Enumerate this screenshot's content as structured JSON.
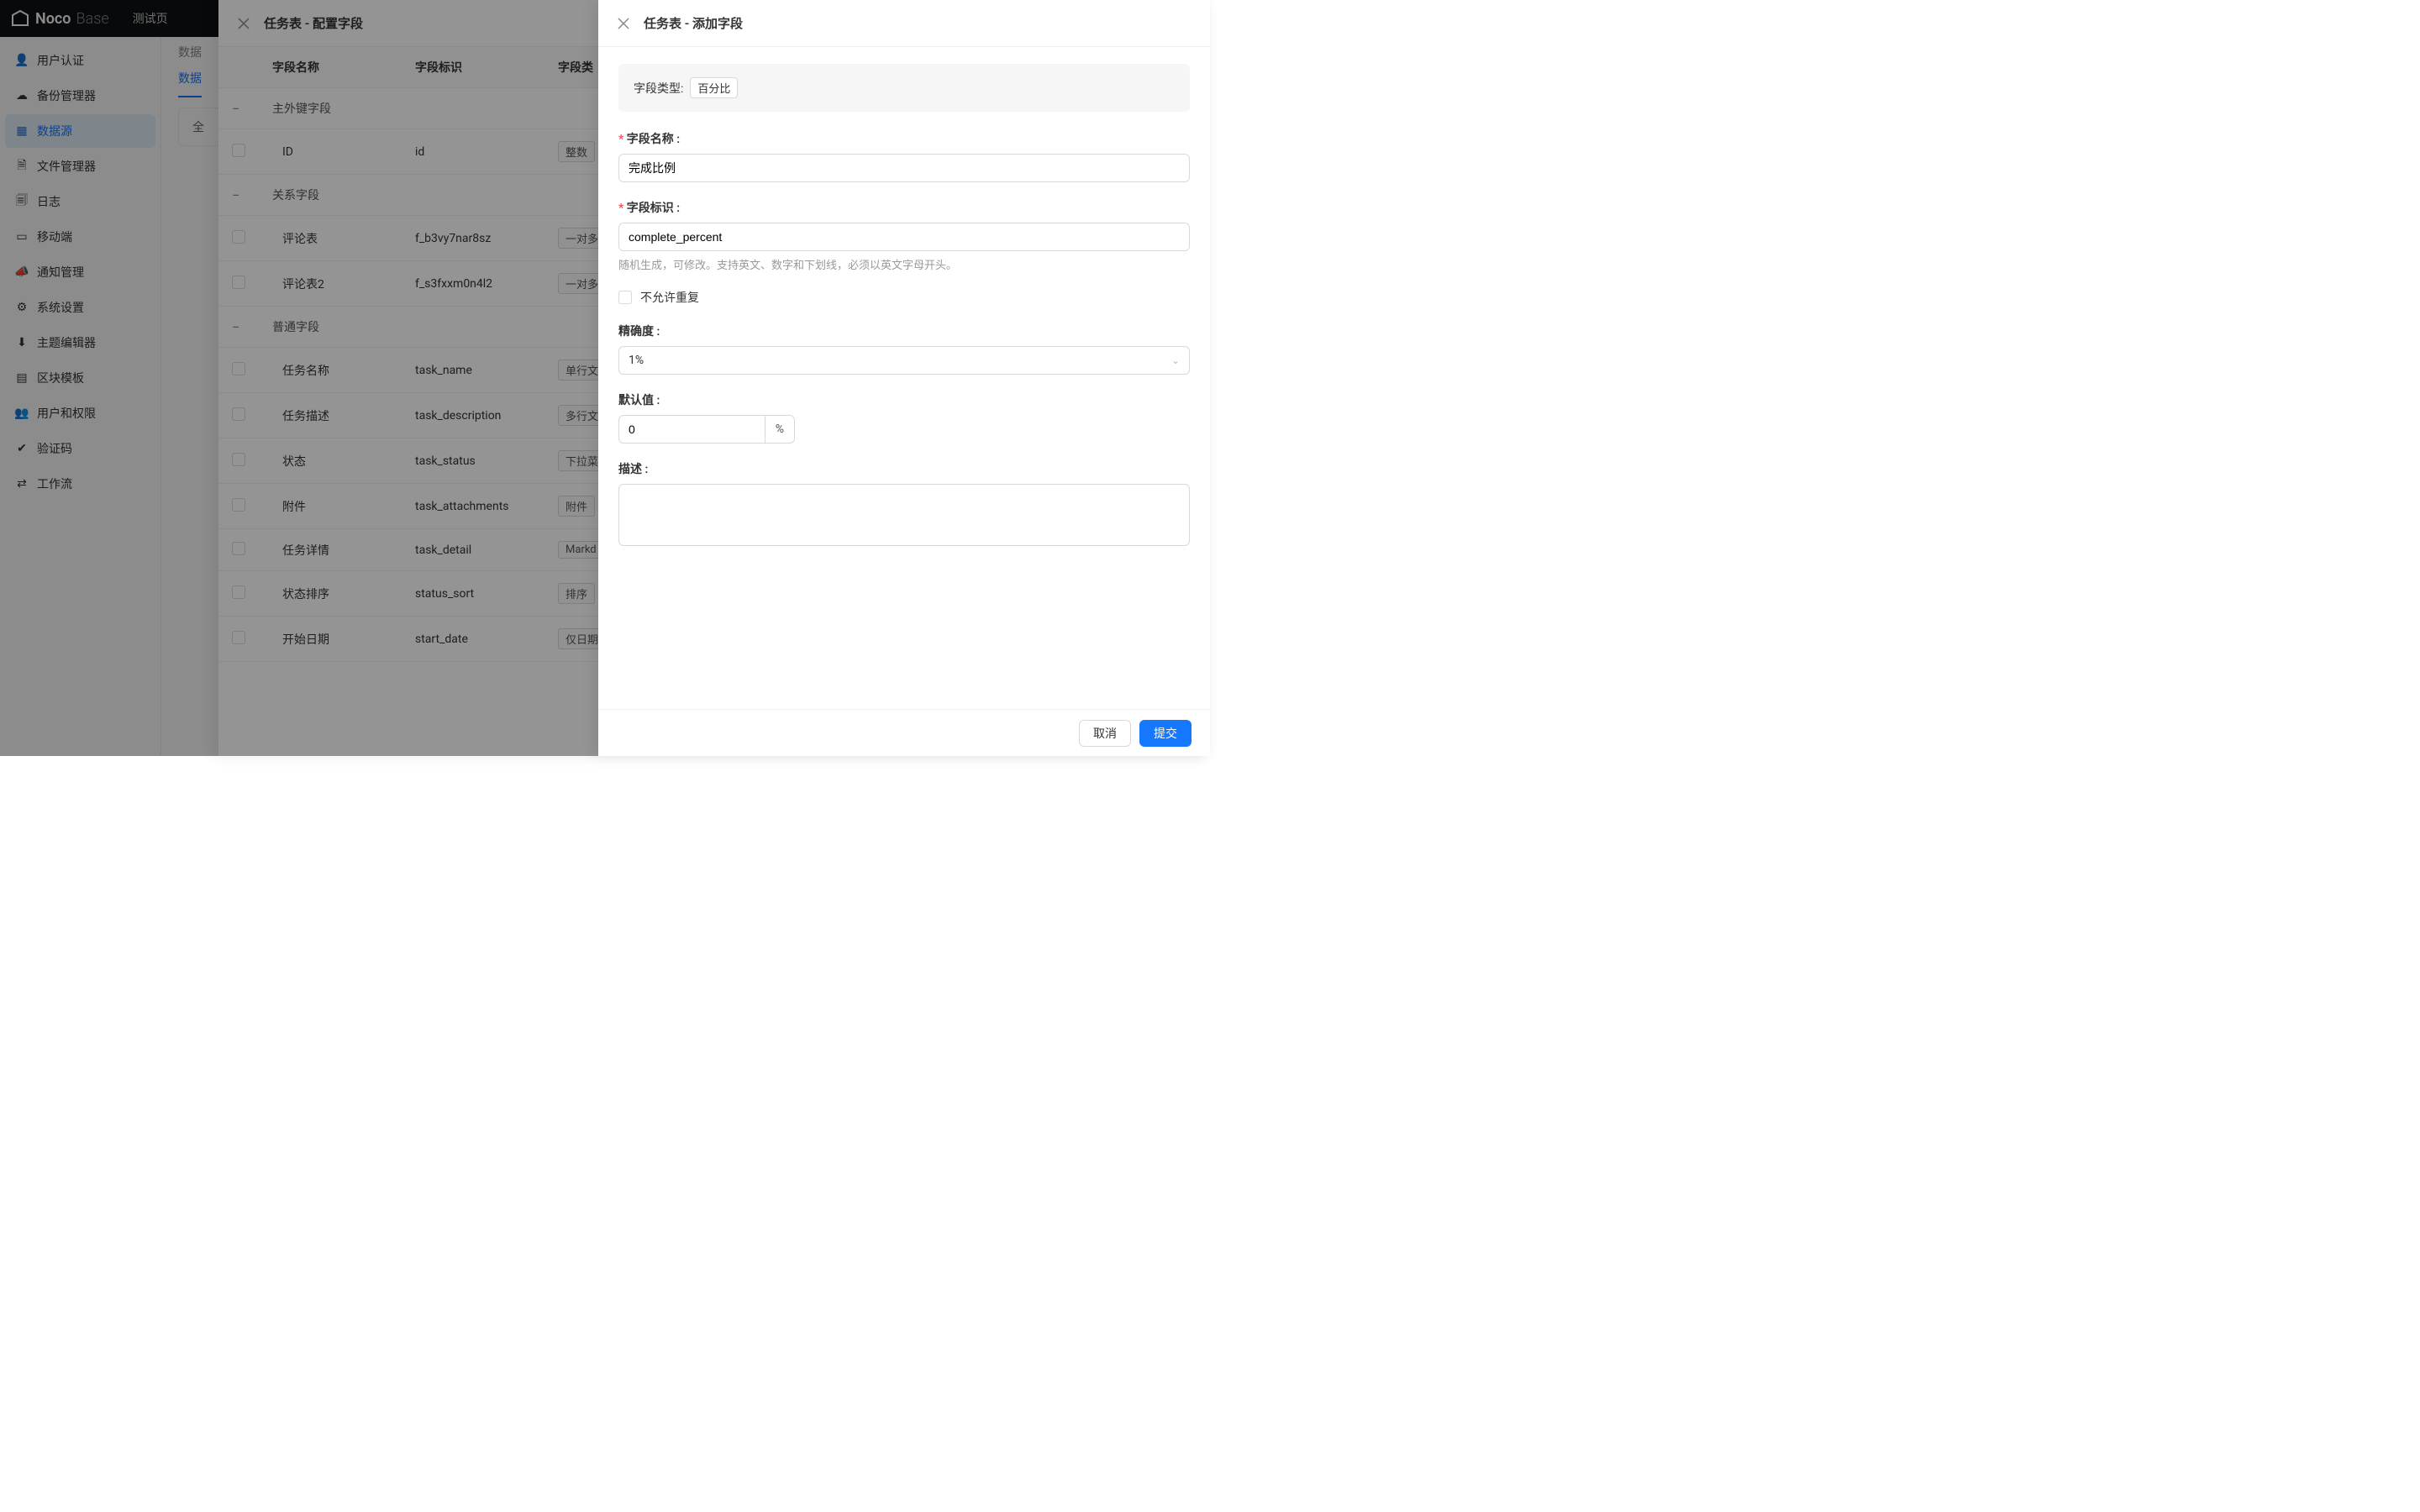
{
  "topbar": {
    "logo_a": "Noco",
    "logo_b": "Base",
    "breadcrumb": "测试页"
  },
  "sidebar": {
    "items": [
      {
        "label": "用户认证"
      },
      {
        "label": "备份管理器"
      },
      {
        "label": "数据源"
      },
      {
        "label": "文件管理器"
      },
      {
        "label": "日志"
      },
      {
        "label": "移动端"
      },
      {
        "label": "通知管理"
      },
      {
        "label": "系统设置"
      },
      {
        "label": "主题编辑器"
      },
      {
        "label": "区块模板"
      },
      {
        "label": "用户和权限"
      },
      {
        "label": "验证码"
      },
      {
        "label": "工作流"
      }
    ]
  },
  "main": {
    "crumb": "数据",
    "tab_active": "数据",
    "filter_label": "全"
  },
  "drawer1": {
    "title": "任务表 - 配置字段",
    "columns": {
      "name": "字段名称",
      "key": "字段标识",
      "type": "字段类"
    },
    "groups": {
      "g1": "主外键字段",
      "g2": "关系字段",
      "g3": "普通字段"
    },
    "rows": [
      {
        "name": "ID",
        "key": "id",
        "type": "整数"
      },
      {
        "name": "评论表",
        "key": "f_b3vy7nar8sz",
        "type": "一对多"
      },
      {
        "name": "评论表2",
        "key": "f_s3fxxm0n4l2",
        "type": "一对多"
      },
      {
        "name": "任务名称",
        "key": "task_name",
        "type": "单行文"
      },
      {
        "name": "任务描述",
        "key": "task_description",
        "type": "多行文"
      },
      {
        "name": "状态",
        "key": "task_status",
        "type": "下拉菜"
      },
      {
        "name": "附件",
        "key": "task_attachments",
        "type": "附件"
      },
      {
        "name": "任务详情",
        "key": "task_detail",
        "type": "Markd"
      },
      {
        "name": "状态排序",
        "key": "status_sort",
        "type": "排序"
      },
      {
        "name": "开始日期",
        "key": "start_date",
        "type": "仅日期"
      }
    ]
  },
  "drawer2": {
    "title": "任务表 - 添加字段",
    "type_label": "字段类型:",
    "type_value": "百分比",
    "fields": {
      "name_label": "字段名称",
      "name_value": "完成比例",
      "key_label": "字段标识",
      "key_value": "complete_percent",
      "key_hint": "随机生成，可修改。支持英文、数字和下划线，必须以英文字母开头。",
      "unique_label": "不允许重复",
      "precision_label": "精确度",
      "precision_value": "1%",
      "default_label": "默认值",
      "default_value": "0",
      "default_addon": "%",
      "desc_label": "描述"
    },
    "buttons": {
      "cancel": "取消",
      "submit": "提交"
    }
  }
}
